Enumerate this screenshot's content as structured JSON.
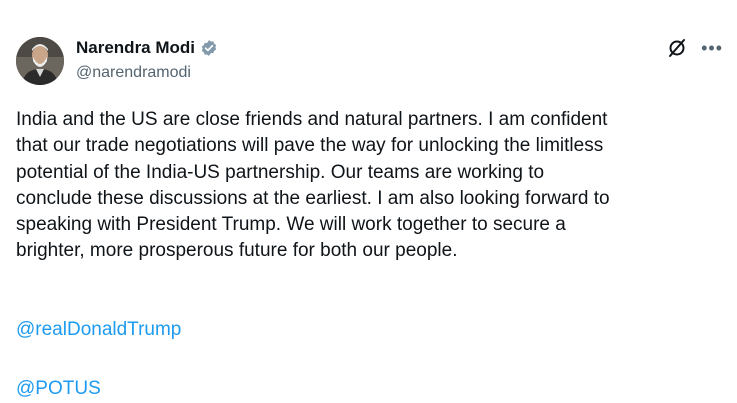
{
  "author": {
    "display_name": "Narendra Modi",
    "handle": "@narendramodi",
    "verified": true
  },
  "icons": {
    "verified": "verified-badge-icon",
    "grok": "grok-icon",
    "more": "more-icon"
  },
  "tweet": {
    "lines": [
      "India and the US are close friends and natural partners. I am confident",
      "that our trade negotiations will pave the way for unlocking the limitless",
      "potential of the India-US partnership. Our teams are working to",
      "conclude these discussions at the earliest. I am also looking forward to",
      "speaking with President Trump. We will work together to secure a",
      "brighter, more prosperous future for both our people."
    ],
    "mentions": [
      "@realDonaldTrump",
      "@POTUS"
    ]
  },
  "colors": {
    "link": "#1d9bf0",
    "handle": "#536471",
    "verified": "#829aab"
  }
}
